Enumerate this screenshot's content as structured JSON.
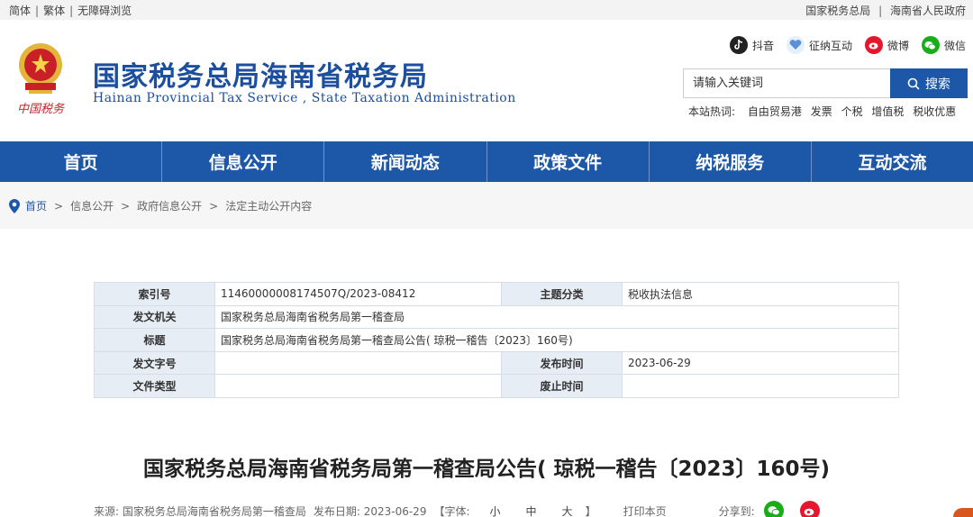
{
  "topbar": {
    "simplified": "简体",
    "traditional": "繁体",
    "accessible": "无障碍浏览",
    "link_sat": "国家税务总局",
    "link_gov": "海南省人民政府"
  },
  "header": {
    "title_cn": "国家税务总局海南省税务局",
    "title_en": "Hainan Provincial Tax Service , State Taxation Administration",
    "emblem_text": "中国税务",
    "emblem_text_note": "logo lettering",
    "social": [
      {
        "label": "抖音",
        "icon": "douyin-icon",
        "color": "#222222"
      },
      {
        "label": "征纳互动",
        "icon": "interaction-icon",
        "color": "#5b8fd6"
      },
      {
        "label": "微博",
        "icon": "weibo-icon",
        "color": "#e6162d"
      },
      {
        "label": "微信",
        "icon": "wechat-icon",
        "color": "#1aad19"
      }
    ],
    "search_placeholder": "请输入关键词",
    "search_button": "搜索",
    "hot_label": "本站热词:",
    "hot_words": [
      "自由贸易港",
      "发票",
      "个税",
      "增值税",
      "税收优惠"
    ]
  },
  "nav": [
    "首页",
    "信息公开",
    "新闻动态",
    "政策文件",
    "纳税服务",
    "互动交流"
  ],
  "breadcrumb": [
    "首页",
    "信息公开",
    "政府信息公开",
    "法定主动公开内容"
  ],
  "info_table": {
    "index_label": "索引号",
    "index_value": "11460000008174507Q/2023-08412",
    "category_label": "主题分类",
    "category_value": "税收执法信息",
    "issuer_label": "发文机关",
    "issuer_value": "国家税务总局海南省税务局第一稽查局",
    "title_label": "标题",
    "title_value": "国家税务总局海南省税务局第一稽查局公告( 琼税一稽告〔2023〕160号)",
    "docno_label": "发文字号",
    "docno_value": "",
    "pubdate_label": "发布时间",
    "pubdate_value": "2023-06-29",
    "type_label": "文件类型",
    "type_value": "",
    "expire_label": "废止时间",
    "expire_value": ""
  },
  "article": {
    "title": "国家税务总局海南省税务局第一稽查局公告( 琼税一稽告〔2023〕160号)",
    "source": "来源:  国家税务总局海南省税务局第一稽查局",
    "date": "发布日期:  2023-06-29",
    "font_label": "【字体:",
    "font_small": "小",
    "font_medium": "中",
    "font_large": "大",
    "font_close": "】",
    "print": "打印本页",
    "share": "分享到:"
  },
  "colors": {
    "brand_blue": "#1c57a8",
    "title_blue": "#1d4fa0"
  }
}
